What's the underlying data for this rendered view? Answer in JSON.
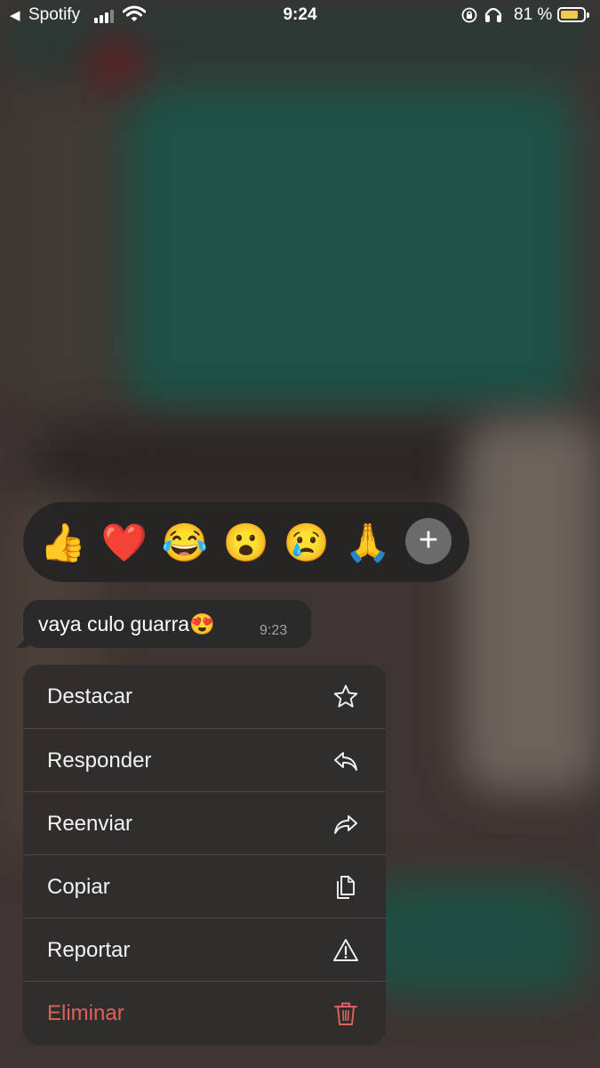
{
  "status_bar": {
    "back_arrow": "◀",
    "back_app": "Spotify",
    "time": "9:24",
    "battery_percent": "81 %",
    "battery_level": 0.81,
    "battery_color": "#f5c94c",
    "icons": [
      "signal-icon",
      "wifi-icon",
      "orientation-lock-icon",
      "headphones-icon",
      "battery-icon"
    ]
  },
  "reactions": {
    "emojis": [
      "👍",
      "❤️",
      "😂",
      "😮",
      "😢",
      "🙏"
    ],
    "more_label": "+"
  },
  "message": {
    "text": "vaya culo guarra😍",
    "time": "9:23"
  },
  "menu": {
    "items": [
      {
        "label": "Destacar",
        "icon": "star-icon"
      },
      {
        "label": "Responder",
        "icon": "reply-icon"
      },
      {
        "label": "Reenviar",
        "icon": "forward-icon"
      },
      {
        "label": "Copiar",
        "icon": "copy-icon"
      },
      {
        "label": "Reportar",
        "icon": "warning-icon"
      },
      {
        "label": "Eliminar",
        "icon": "trash-icon",
        "color": "#e0615c"
      }
    ]
  }
}
